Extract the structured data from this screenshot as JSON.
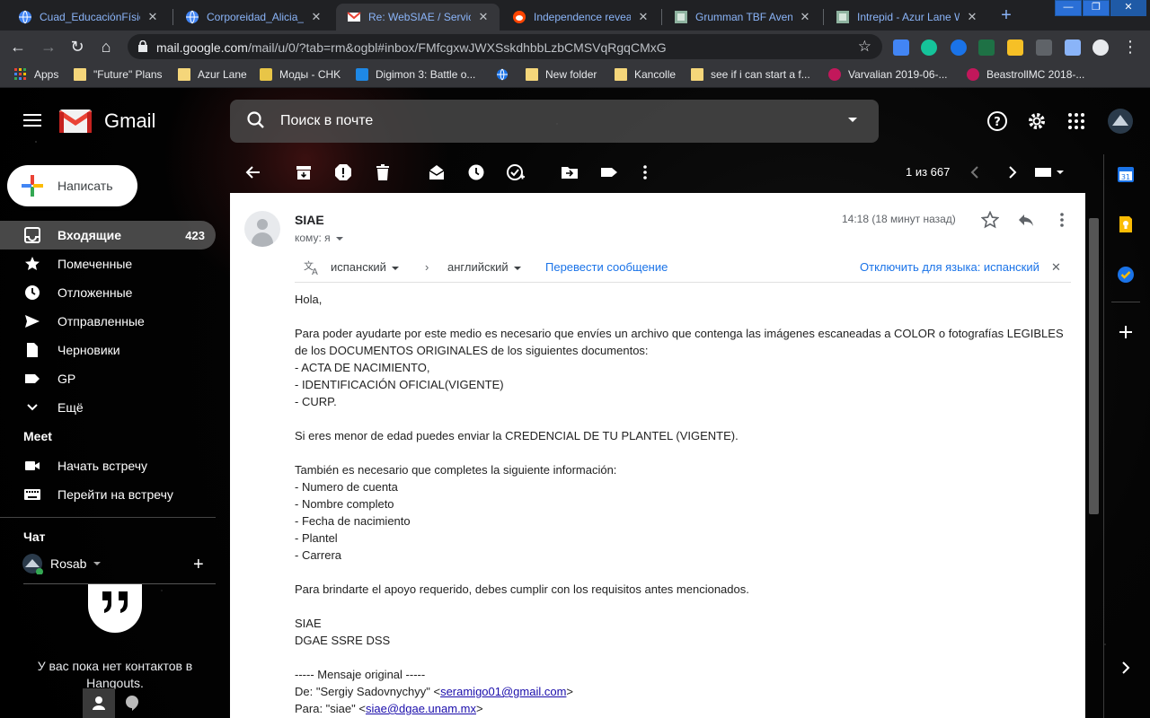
{
  "browser": {
    "tabs": [
      {
        "title": "Cuad_EducaciónFísica",
        "active": false
      },
      {
        "title": "Corporeidad_Alicia_Gr",
        "active": false
      },
      {
        "title": "Re: WebSIAE / Servicio",
        "active": true
      },
      {
        "title": "Independence reveale",
        "active": false
      },
      {
        "title": "Grumman TBF Avenge",
        "active": false
      },
      {
        "title": "Intrepid - Azur Lane W",
        "active": false
      }
    ],
    "new_tab": "+",
    "url_host": "mail.google.com",
    "url_path": "/mail/u/0/?tab=rm&ogbl#inbox/FMfcgxwJWXSskdhbbLzbCMSVqRgqCMxG",
    "bookmarks": [
      {
        "label": "Apps",
        "icon": "apps-grid-icon"
      },
      {
        "label": "\"Future\" Plans",
        "icon": "folder-icon"
      },
      {
        "label": "Azur Lane",
        "icon": "folder-icon"
      },
      {
        "label": "Моды - CHK",
        "icon": "site-icon"
      },
      {
        "label": "Digimon 3: Battle o...",
        "icon": "site-icon"
      },
      {
        "label": "",
        "icon": "globe-icon"
      },
      {
        "label": "New folder",
        "icon": "folder-icon"
      },
      {
        "label": "Kancolle",
        "icon": "folder-icon"
      },
      {
        "label": "see if i can start a f...",
        "icon": "folder-icon"
      },
      {
        "label": "Varvalian 2019-06-...",
        "icon": "site-icon"
      },
      {
        "label": "BeastrollMC 2018-...",
        "icon": "site-icon"
      }
    ]
  },
  "gmail": {
    "brand": "Gmail",
    "search_placeholder": "Поиск в почте",
    "compose": "Написать",
    "nav": [
      {
        "label": "Входящие",
        "count": "423",
        "selected": true,
        "icon": "inbox-icon"
      },
      {
        "label": "Помеченные",
        "count": "",
        "selected": false,
        "icon": "star-icon"
      },
      {
        "label": "Отложенные",
        "count": "",
        "selected": false,
        "icon": "clock-icon"
      },
      {
        "label": "Отправленные",
        "count": "",
        "selected": false,
        "icon": "send-icon"
      },
      {
        "label": "Черновики",
        "count": "",
        "selected": false,
        "icon": "draft-icon"
      },
      {
        "label": "GP",
        "count": "",
        "selected": false,
        "icon": "label-icon"
      },
      {
        "label": "Ещё",
        "count": "",
        "selected": false,
        "icon": "chevron-down-icon"
      }
    ],
    "meet": {
      "heading": "Meet",
      "items": [
        {
          "label": "Начать встречу",
          "icon": "video-icon"
        },
        {
          "label": "Перейти на встречу",
          "icon": "keyboard-icon"
        }
      ]
    },
    "chat": {
      "heading": "Чат",
      "user": "Rosab",
      "empty_text": "У вас пока нет контактов в Hangouts."
    },
    "pager": "1 из 667",
    "message": {
      "sender": "SIAE",
      "to": "кому: я",
      "time": "14:18 (18 минут назад)",
      "translate": {
        "from_lang": "испанский",
        "to_lang": "английский",
        "action": "Перевести сообщение",
        "disable": "Отключить для языка: испанский"
      },
      "body_lines": [
        "Hola,",
        "",
        "Para poder ayudarte por este medio es necesario que envíes un archivo que contenga las imágenes escaneadas a COLOR o fotografías LEGIBLES",
        "de los DOCUMENTOS ORIGINALES de los siguientes documentos:",
        "- ACTA DE NACIMIENTO,",
        "- IDENTIFICACIÓN OFICIAL(VIGENTE)",
        "- CURP.",
        "",
        "Si eres menor de edad puedes enviar la CREDENCIAL DE TU PLANTEL (VIGENTE).",
        "",
        "También es necesario que completes la siguiente información:",
        " - Numero de cuenta",
        " - Nombre completo",
        " - Fecha de nacimiento",
        " - Plantel",
        " - Carrera",
        "",
        "Para brindarte el apoyo requerido, debes cumplir con los requisitos antes mencionados.",
        "",
        "SIAE",
        "DGAE SSRE DSS",
        "",
        "----- Mensaje original -----"
      ],
      "from_prefix": "De: \"Sergiy Sadovnychyy\" <",
      "from_email": "seramigo01@gmail.com",
      "from_suffix": ">",
      "to_prefix": "Para: \"siae\" <",
      "to_email": "siae@dgae.unam.mx",
      "to_suffix": ">"
    }
  },
  "colors": {
    "accent_blue": "#1a73e8",
    "chrome_dark": "#202124",
    "gmail_red": "#ea4335"
  }
}
